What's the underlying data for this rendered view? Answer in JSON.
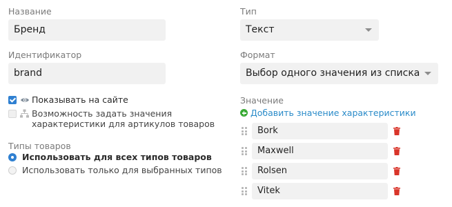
{
  "left": {
    "name_label": "Название",
    "name_value": "Бренд",
    "id_label": "Идентификатор",
    "id_value": "brand",
    "show_on_site": "Показывать на сайте",
    "sku_option": "Возможность задать значения характеристики для артикулов товаров",
    "product_types_label": "Типы товаров",
    "radio_all": "Использовать для всех типов товаров",
    "radio_selected": "Использовать только для выбранных типов"
  },
  "right": {
    "type_label": "Тип",
    "type_value": "Текст",
    "format_label": "Формат",
    "format_value": "Выбор одного значения из списка",
    "values_label": "Значение",
    "add_value_link": "Добавить значение характеристики",
    "values": [
      "Bork",
      "Maxwell",
      "Rolsen",
      "Vitek"
    ]
  },
  "colors": {
    "accent": "#2f80d1",
    "link": "#2a8bc9",
    "delete": "#d9352a",
    "add": "#3aaa35"
  },
  "icons": [
    "eye-icon",
    "hierarchy-icon",
    "plus-circle-icon",
    "drag-handle-icon",
    "trash-icon",
    "chevron-down-icon"
  ]
}
